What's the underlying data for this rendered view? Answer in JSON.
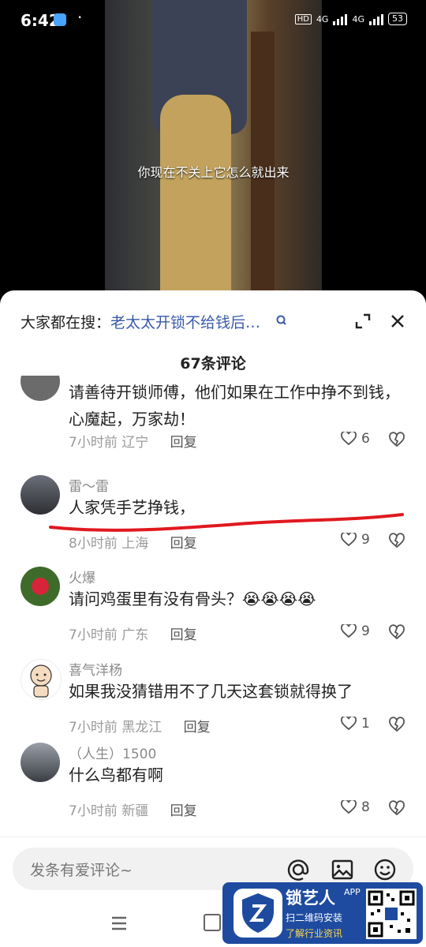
{
  "status_bar": {
    "time": "6:42",
    "network_1": "4G",
    "network_2": "4G",
    "hd_label": "HD",
    "battery": "53"
  },
  "video": {
    "caption": "你现在不关上它怎么就出来"
  },
  "search_bar": {
    "label": "大家都在搜：",
    "keyword": "老太太开锁不给钱后…"
  },
  "comments_header": {
    "count": "67条评论"
  },
  "comments": [
    {
      "text": "请善待开锁师傅，他们如果在工作中挣不到钱，心魔起，万家劫！",
      "time": "7小时前",
      "location": "辽宁",
      "reply": "回复",
      "likes": "6"
    },
    {
      "name": "雷～雷",
      "text": "人家凭手艺挣钱，",
      "time": "8小时前",
      "location": "上海",
      "reply": "回复",
      "likes": "9"
    },
    {
      "name": "火爆",
      "text": "请问鸡蛋里有没有骨头？😭😭😭😭",
      "time": "7小时前",
      "location": "广东",
      "reply": "回复",
      "likes": "9"
    },
    {
      "name": "喜气洋杨",
      "text": "如果我没猜错用不了几天这套锁就得换了",
      "time": "7小时前",
      "location": "黑龙江",
      "reply": "回复",
      "likes": "1"
    },
    {
      "name": "（人生）1500",
      "text": "什么鸟都有啊",
      "time": "7小时前",
      "location": "新疆",
      "reply": "回复",
      "likes": "8"
    }
  ],
  "input": {
    "placeholder": "发条有爱评论~"
  },
  "ad": {
    "brand": "锁艺人",
    "app_tag": "APP",
    "line1": "扫二维码安装",
    "line2": "了解行业资讯"
  },
  "colors": {
    "accent_blue": "#3a5aa8",
    "underline_red": "#e0191f",
    "ad_bg": "#1e4ba0"
  }
}
